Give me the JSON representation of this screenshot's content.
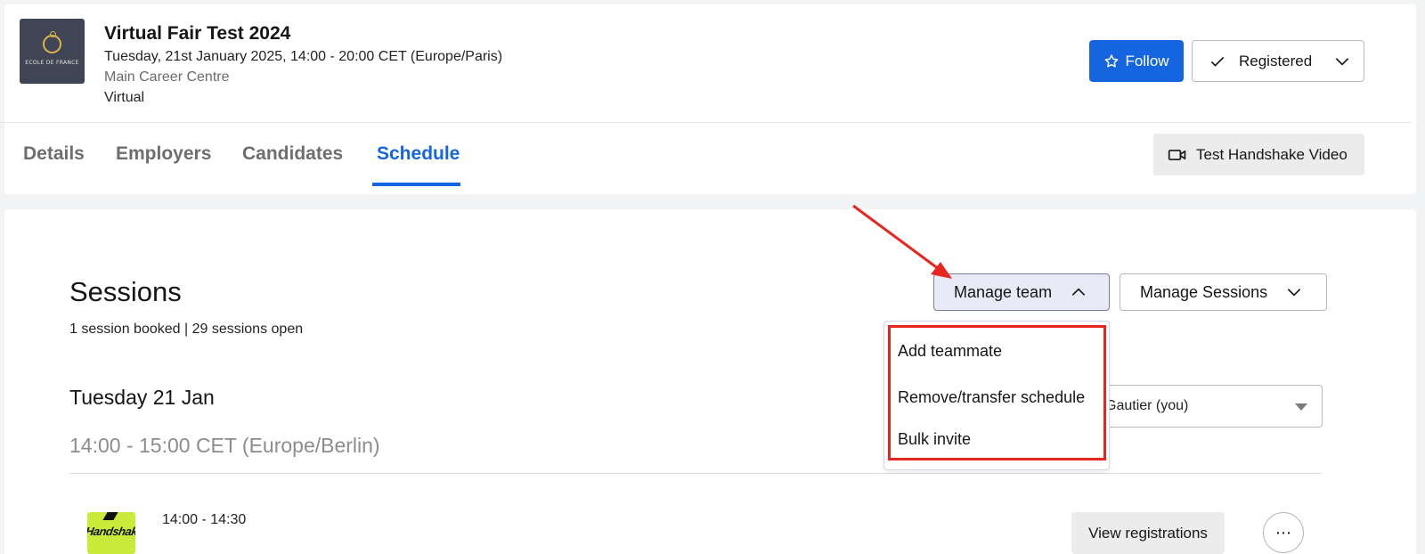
{
  "event": {
    "logo_text": "ECOLE DE FRANCE",
    "title": "Virtual Fair Test 2024",
    "date": "Tuesday, 21st January 2025, 14:00 - 20:00 CET (Europe/Paris)",
    "centre": "Main Career Centre",
    "location": "Virtual"
  },
  "header_actions": {
    "follow_label": "Follow",
    "registered_label": "Registered"
  },
  "tabs": [
    {
      "label": "Details",
      "active": false
    },
    {
      "label": "Employers",
      "active": false
    },
    {
      "label": "Candidates",
      "active": false
    },
    {
      "label": "Schedule",
      "active": true
    }
  ],
  "video_button_label": "Test Handshake Video",
  "sessions": {
    "title": "Sessions",
    "summary": "1 session booked | 29 sessions open",
    "manage_team_label": "Manage team",
    "manage_sessions_label": "Manage Sessions",
    "manage_team_menu": [
      "Add teammate",
      "Remove/transfer schedule",
      "Bulk invite"
    ],
    "member_select_value": "Gautier (you)",
    "day": "Tuesday 21 Jan",
    "time_range": "14:00 - 15:00 CET (Europe/Berlin)"
  },
  "slot": {
    "logo_text": "Handshake",
    "time": "14:00 - 14:30",
    "view_registrations_label": "View registrations",
    "more_label": "⋯"
  },
  "colors": {
    "primary": "#1565e0",
    "annotation_red": "#e6261f",
    "company_logo_bg": "#cbeb3a"
  },
  "icons": [
    "star-icon",
    "check-icon",
    "chevron-down-icon",
    "chevron-up-icon",
    "video-camera-icon",
    "ellipsis-icon"
  ]
}
